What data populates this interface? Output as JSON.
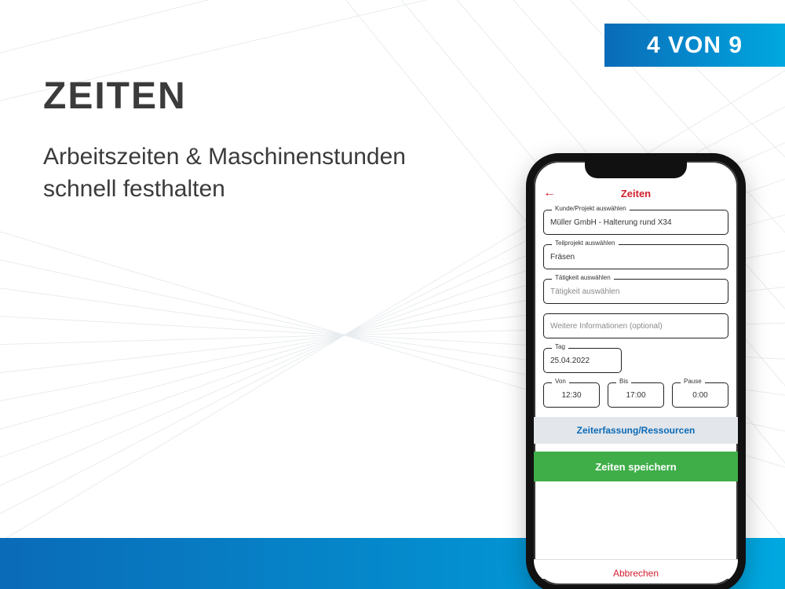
{
  "badge": "4 VON 9",
  "heading": "ZEITEN",
  "subtitle": "Arbeitszeiten & Maschinenstunden schnell festhalten",
  "app": {
    "header_title": "Zeiten",
    "back_icon": "←",
    "fields": {
      "project": {
        "label": "Kunde/Projekt auswählen",
        "value": "Müller GmbH - Halterung rund X34"
      },
      "subproject": {
        "label": "Teilprojekt auswählen",
        "value": "Fräsen"
      },
      "activity": {
        "label": "Tätigkeit auswählen",
        "value": "Tätigkeit auswählen"
      },
      "notes": {
        "placeholder": "Weitere Informationen (optional)"
      },
      "day": {
        "label": "Tag",
        "value": "25.04.2022"
      },
      "from": {
        "label": "Von",
        "value": "12:30"
      },
      "to": {
        "label": "Bis",
        "value": "17:00"
      },
      "pause": {
        "label": "Pause",
        "value": "0:00"
      }
    },
    "link": "Zeiterfassung/Ressourcen",
    "save": "Zeiten speichern",
    "cancel": "Abbrechen"
  }
}
